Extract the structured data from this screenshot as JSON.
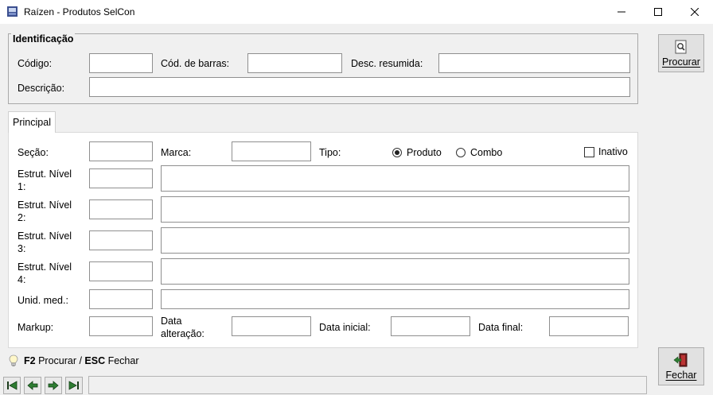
{
  "window": {
    "title": "Raízen - Produtos SelCon",
    "icons": [
      "app-icon",
      "minimize-icon",
      "maximize-icon",
      "close-icon"
    ]
  },
  "identificacao": {
    "legend": "Identificação",
    "codigo_label": "Código:",
    "codigo_value": "",
    "cod_barras_label": "Cód. de barras:",
    "cod_barras_value": "",
    "desc_resumida_label": "Desc. resumida:",
    "desc_resumida_value": "",
    "descricao_label": "Descrição:",
    "descricao_value": ""
  },
  "tabs": [
    {
      "label": "Principal",
      "active": true
    }
  ],
  "principal": {
    "secao_label": "Seção:",
    "marca_label": "Marca:",
    "tipo_label": "Tipo:",
    "tipo_options": [
      "Produto",
      "Combo"
    ],
    "tipo_selected": "Produto",
    "inativo_label": "Inativo",
    "inativo_checked": false,
    "estrut_labels": [
      "Estrut. Nível 1:",
      "Estrut. Nível 2:",
      "Estrut. Nível 3:",
      "Estrut. Nível 4:"
    ],
    "unid_med_label": "Unid. med.:",
    "markup_label": "Markup:",
    "data_alteracao_label": "Data alteração:",
    "data_inicial_label": "Data inicial:",
    "data_final_label": "Data final:"
  },
  "sidebar": {
    "procurar_label": "Procurar",
    "procurar_icon": "search-document-icon",
    "fechar_label": "Fechar",
    "fechar_icon": "exit-door-icon"
  },
  "hint": {
    "icon": "lightbulb-icon",
    "key1": "F2",
    "text1": " Procurar / ",
    "key2": "ESC",
    "text2": " Fechar"
  },
  "navigation": {
    "icons": [
      "first-record-icon",
      "previous-record-icon",
      "next-record-icon",
      "last-record-icon"
    ]
  },
  "status_text": ""
}
